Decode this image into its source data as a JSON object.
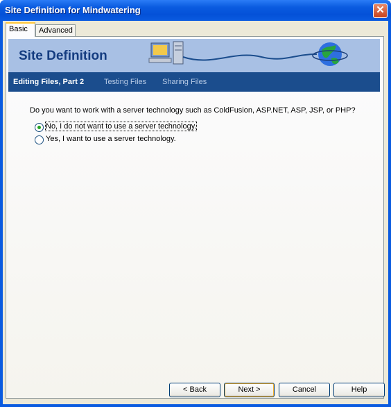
{
  "window": {
    "title": "Site Definition for Mindwatering",
    "close_glyph": "✕"
  },
  "tabs": [
    {
      "label": "Basic",
      "active": true
    },
    {
      "label": "Advanced",
      "active": false
    }
  ],
  "banner": {
    "title": "Site Definition"
  },
  "steps": [
    {
      "label": "Editing Files, Part 2",
      "current": true
    },
    {
      "label": "Testing Files"
    },
    {
      "label": "Sharing Files"
    }
  ],
  "question": "Do you want to work with a server technology such as ColdFusion, ASP.NET, ASP, JSP, or PHP?",
  "options": [
    {
      "label": "No, I do not want to use a server technology.",
      "selected": true
    },
    {
      "label": "Yes, I want to use a server technology.",
      "selected": false
    }
  ],
  "buttons": {
    "back": "< Back",
    "next": "Next >",
    "cancel": "Cancel",
    "help": "Help"
  },
  "colors": {
    "titlebar": "#0a5be0",
    "banner": "#a8c0e4",
    "steps_bar": "#1b4d8d",
    "default_button": "#f8b330"
  }
}
